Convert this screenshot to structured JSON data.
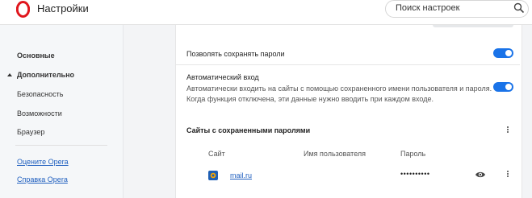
{
  "app": {
    "title": "Настройки"
  },
  "search": {
    "placeholder": "Поиск настроек"
  },
  "sidebar": {
    "items": [
      {
        "label": "Основные"
      },
      {
        "label": "Дополнительно"
      },
      {
        "label": "Безопасность"
      },
      {
        "label": "Возможности"
      },
      {
        "label": "Браузер"
      }
    ],
    "links": [
      {
        "label": "Оцените Opera"
      },
      {
        "label": "Справка Opera"
      }
    ]
  },
  "settings": {
    "allow_save": {
      "label": "Позволять сохранять пароли",
      "enabled": true
    },
    "auto_login": {
      "label": "Автоматический вход",
      "desc_line1": "Автоматически входить на сайты с помощью сохраненного имени пользователя и пароля.",
      "desc_line2": "Когда функция отключена, эти данные нужно вводить при каждом входе.",
      "enabled": true
    }
  },
  "saved_passwords": {
    "title": "Сайты с сохраненными паролями",
    "columns": {
      "site": "Сайт",
      "username": "Имя пользователя",
      "password": "Пароль"
    },
    "rows": [
      {
        "site": "mail.ru",
        "username": "",
        "password": "••••••••••"
      }
    ]
  },
  "colors": {
    "accent": "#1a73e8",
    "link": "#1f5fbf",
    "brand_red": "#e0161d"
  }
}
